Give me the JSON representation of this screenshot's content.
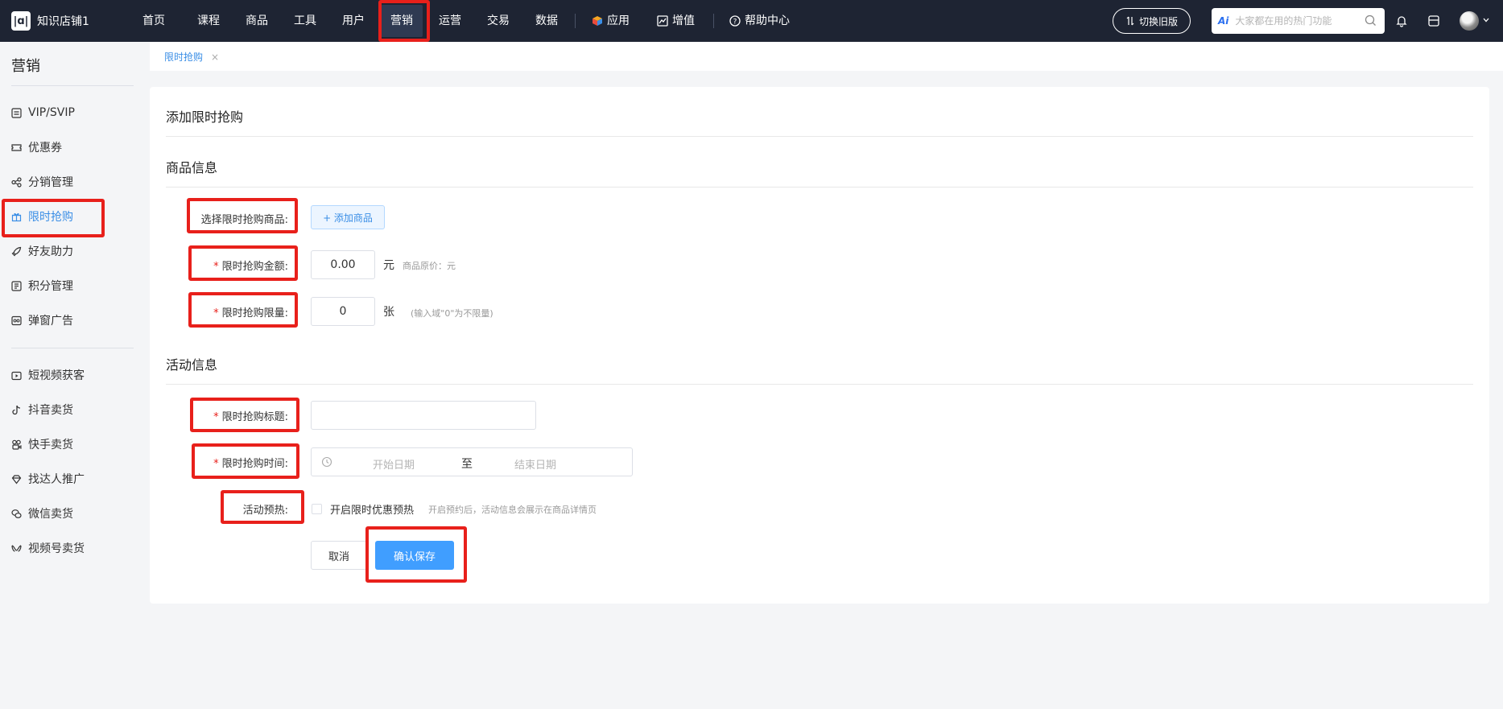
{
  "app": {
    "logo_mark": "|ɑ|",
    "store_name": "知识店铺1"
  },
  "nav": {
    "items": [
      {
        "label": "首页"
      },
      {
        "label": "课程"
      },
      {
        "label": "商品"
      },
      {
        "label": "工具"
      },
      {
        "label": "用户"
      },
      {
        "label": "营销",
        "active": true
      },
      {
        "label": "运营"
      },
      {
        "label": "交易"
      },
      {
        "label": "数据"
      },
      {
        "label": "应用",
        "icon": "cube-icon"
      },
      {
        "label": "增值",
        "icon": "chart-icon"
      },
      {
        "label": "帮助中心",
        "icon": "help-circle-icon"
      }
    ],
    "switch_label": "切换旧版",
    "search_badge": "Ai",
    "search_placeholder": "大家都在用的热门功能"
  },
  "sidebar": {
    "title": "营销",
    "group1": [
      {
        "label": "VIP/SVIP",
        "icon": "vip-card-icon"
      },
      {
        "label": "优惠券",
        "icon": "ticket-icon"
      },
      {
        "label": "分销管理",
        "icon": "share-icon"
      },
      {
        "label": "限时抢购",
        "icon": "gift-icon",
        "active": true
      },
      {
        "label": "好友助力",
        "icon": "rocket-icon"
      },
      {
        "label": "积分管理",
        "icon": "points-icon"
      },
      {
        "label": "弹窗广告",
        "icon": "popup-ad-icon"
      }
    ],
    "group2": [
      {
        "label": "短视频获客",
        "icon": "video-icon"
      },
      {
        "label": "抖音卖货",
        "icon": "tiktok-icon"
      },
      {
        "label": "快手卖货",
        "icon": "kuaishou-icon"
      },
      {
        "label": "找达人推广",
        "icon": "diamond-icon"
      },
      {
        "label": "微信卖货",
        "icon": "wechat-icon"
      },
      {
        "label": "视频号卖货",
        "icon": "channels-icon"
      }
    ]
  },
  "tabs": [
    {
      "label": "限时抢购",
      "close": "×"
    }
  ],
  "form": {
    "title": "添加限时抢购",
    "product_section": "商品信息",
    "select_product_label": "选择限时抢购商品:",
    "add_product_button": "+ 添加商品",
    "amount_label": "限时抢购金额:",
    "amount_value": "0.00",
    "amount_unit": "元",
    "amount_hint": "商品原价：元",
    "limit_label": "限时抢购限量:",
    "limit_value": "0",
    "limit_unit": "张",
    "limit_hint": "(输入域\"0\"为不限量)",
    "activity_section": "活动信息",
    "title_label": "限时抢购标题:",
    "time_label": "限时抢购时间:",
    "start_placeholder": "开始日期",
    "range_sep": "至",
    "end_placeholder": "结束日期",
    "preheat_label": "活动预热:",
    "preheat_checkbox_label": "开启限时优惠预热",
    "preheat_hint": "开启预约后，活动信息会展示在商品详情页",
    "required_mark": "*",
    "cancel_button": "取消",
    "save_button": "确认保存"
  },
  "colors": {
    "topbar": "#1e2433",
    "accent": "#409eff",
    "highlight": "#e8201b"
  }
}
